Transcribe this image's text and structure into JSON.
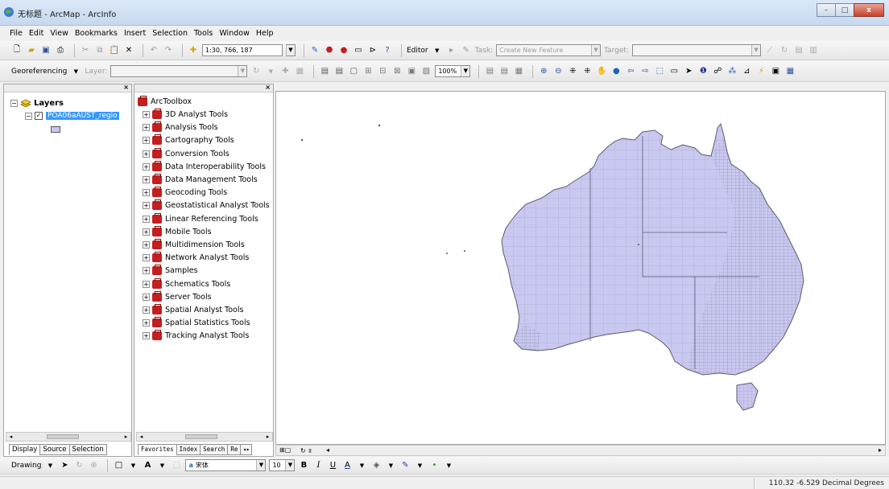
{
  "window": {
    "title": "无标题 - ArcMap - ArcInfo",
    "controls": [
      "–",
      "□",
      "x"
    ]
  },
  "menu": [
    "File",
    "Edit",
    "View",
    "Bookmarks",
    "Insert",
    "Selection",
    "Tools",
    "Window",
    "Help"
  ],
  "standard_toolbar": {
    "scale": "1:30, 766, 187",
    "editor_label": "Editor",
    "task_label": "Task:",
    "task_value": "Create New Feature",
    "target_label": "Target:",
    "target_value": ""
  },
  "georef_toolbar": {
    "label": "Georeferencing",
    "layer_label": "Layer:",
    "layer_value": "",
    "zoom_value": "100%"
  },
  "toc": {
    "root_label": "Layers",
    "layer_name": "POA06aAUST_regio",
    "symbol_color": "#c9c8f0",
    "tabs": [
      "Display",
      "Source",
      "Selection"
    ]
  },
  "toolbox": {
    "root_label": "ArcToolbox",
    "items": [
      "3D Analyst Tools",
      "Analysis Tools",
      "Cartography Tools",
      "Conversion Tools",
      "Data Interoperability Tools",
      "Data Management Tools",
      "Geocoding Tools",
      "Geostatistical Analyst Tools",
      "Linear Referencing Tools",
      "Mobile Tools",
      "Multidimension Tools",
      "Network Analyst Tools",
      "Samples",
      "Schematics Tools",
      "Server Tools",
      "Spatial Analyst Tools",
      "Spatial Statistics Tools",
      "Tracking Analyst Tools"
    ],
    "tabs": [
      "Favorites",
      "Index",
      "Search",
      "Re"
    ]
  },
  "map": {
    "fill_color": "#c9c8f0",
    "stroke_color": "#6e6e86"
  },
  "drawing_toolbar": {
    "label": "Drawing",
    "font_name": "宋体",
    "font_size": "10",
    "bold": "B",
    "italic": "I",
    "underline": "U",
    "text_a": "A"
  },
  "status": {
    "coordinates": "110.32  -6.529 Decimal Degrees"
  }
}
